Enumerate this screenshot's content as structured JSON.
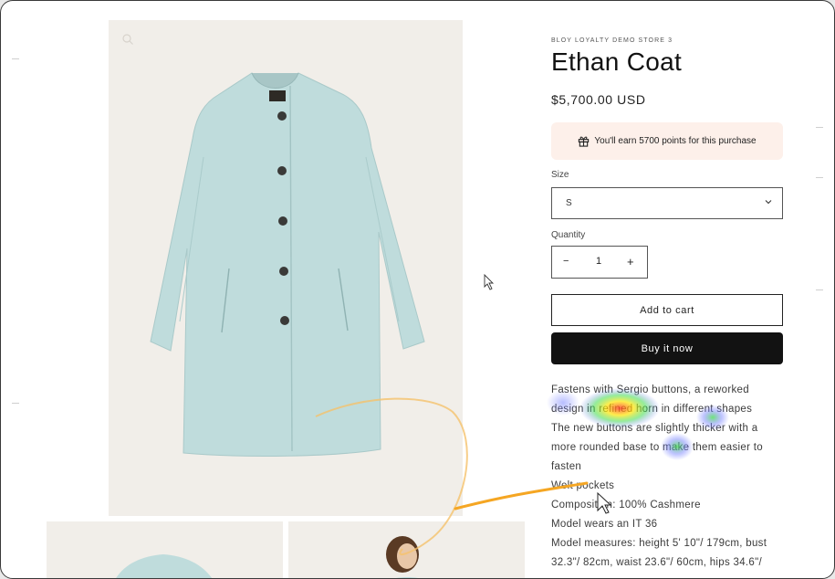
{
  "product": {
    "vendor": "BLOY LOYALTY DEMO STORE 3",
    "title": "Ethan Coat",
    "price": "$5,700.00 USD",
    "loyalty_message": "You'll earn 5700 points for this purchase",
    "size_label": "Size",
    "size_value": "S",
    "quantity_label": "Quantity",
    "quantity_value": "1",
    "quantity_minus": "−",
    "quantity_plus": "+",
    "add_to_cart": "Add to cart",
    "buy_now": "Buy it now",
    "description": [
      "Fastens with Sergio buttons, a reworked",
      "design in refined horn in different shapes",
      "The new buttons are slightly thicker with a",
      "more rounded base to make them easier to",
      "fasten",
      "Welt pockets",
      "Composition: 100% Cashmere",
      "Model wears an IT 36",
      "Model measures: height 5' 10\"/ 179cm, bust",
      "32.3\"/ 82cm, waist 23.6\"/ 60cm, hips 34.6\"/"
    ]
  },
  "icons": {
    "gift": "gift-icon",
    "zoom": "zoom-icon",
    "chevron": "chevron-down-icon",
    "cursor": "cursor-icon"
  },
  "colors": {
    "coat": "#bfdcdc",
    "image_bg": "#f1eee9",
    "loyalty_bg": "#fdf0ea",
    "buy_button": "#121212",
    "trail": "#f5a623"
  }
}
